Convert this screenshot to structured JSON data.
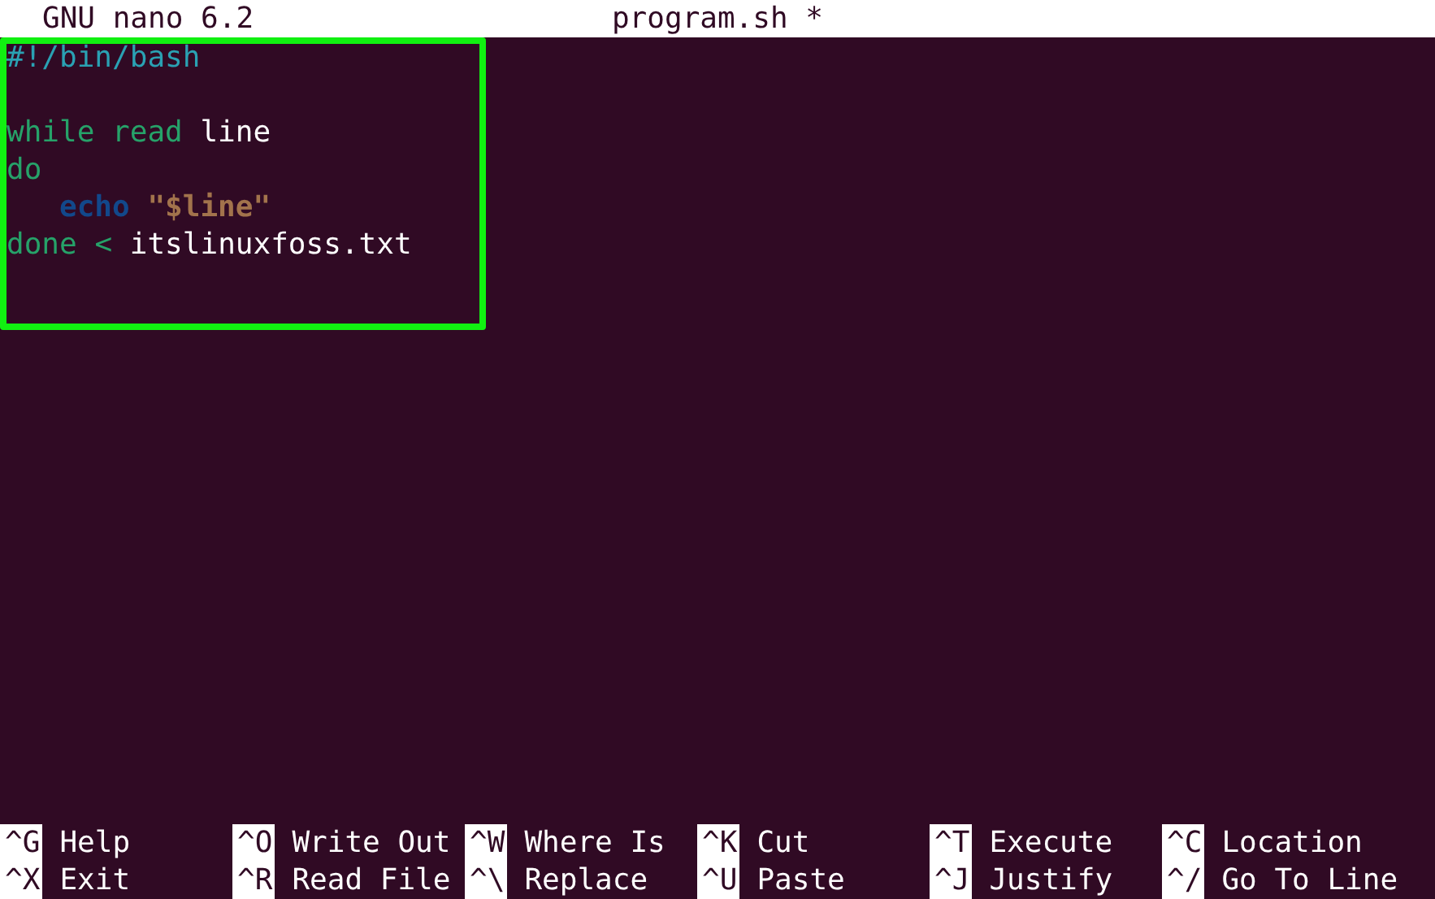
{
  "title_bar": {
    "app": "GNU nano 6.2",
    "file": "program.sh *"
  },
  "code_lines": [
    {
      "kind": "code",
      "indented": false,
      "tokens": [
        {
          "kind": "comment",
          "text": "#!/bin/bash"
        }
      ]
    },
    {
      "kind": "blank"
    },
    {
      "kind": "code",
      "indented": false,
      "tokens": [
        {
          "kind": "keyword",
          "text": "while"
        },
        {
          "kind": "keyword",
          "text": " read"
        },
        {
          "kind": "plain",
          "text": " line"
        }
      ]
    },
    {
      "kind": "code",
      "indented": false,
      "tokens": [
        {
          "kind": "keyword",
          "text": "do"
        }
      ]
    },
    {
      "kind": "code",
      "indented": true,
      "tokens": [
        {
          "kind": "builtin",
          "text": "echo"
        },
        {
          "kind": "string",
          "text": " \"$line\""
        }
      ]
    },
    {
      "kind": "code",
      "indented": false,
      "tokens": [
        {
          "kind": "keyword",
          "text": "done"
        },
        {
          "kind": "keyword",
          "text": " <"
        },
        {
          "kind": "plain",
          "text": " itslinuxfoss.txt"
        }
      ]
    }
  ],
  "shortcuts": [
    [
      {
        "key": "^G",
        "label": "Help"
      },
      {
        "key": "^O",
        "label": "Write Out"
      },
      {
        "key": "^W",
        "label": "Where Is"
      },
      {
        "key": "^K",
        "label": "Cut"
      },
      {
        "key": "^T",
        "label": "Execute"
      },
      {
        "key": "^C",
        "label": "Location"
      }
    ],
    [
      {
        "key": "^X",
        "label": "Exit"
      },
      {
        "key": "^R",
        "label": "Read File"
      },
      {
        "key": "^\\",
        "label": "Replace"
      },
      {
        "key": "^U",
        "label": "Paste"
      },
      {
        "key": "^J",
        "label": "Justify"
      },
      {
        "key": "^/",
        "label": "Go To Line"
      }
    ]
  ]
}
